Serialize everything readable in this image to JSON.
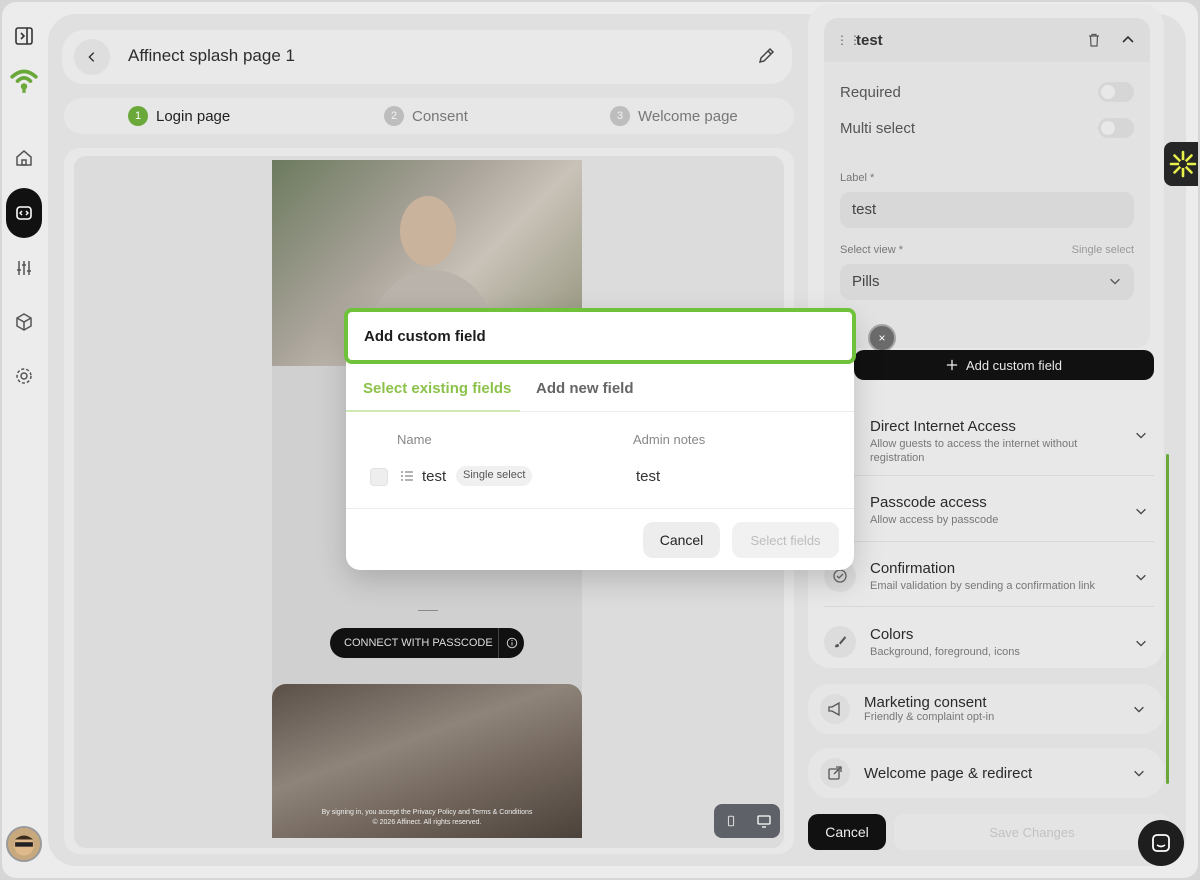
{
  "header": {
    "title": "Affinect splash page 1"
  },
  "steps": [
    {
      "num": "1",
      "label": "Login page"
    },
    {
      "num": "2",
      "label": "Consent"
    },
    {
      "num": "3",
      "label": "Welcome page"
    }
  ],
  "preview": {
    "connect_label": "CONNECT WITH PASSCODE",
    "legal_line1": "By signing in, you accept the Privacy Policy and Terms & Conditions",
    "legal_line2": "© 2026 Affinect. All rights reserved."
  },
  "field_card": {
    "name": "test",
    "required_label": "Required",
    "multi_select_label": "Multi select",
    "label_label": "Label *",
    "label_value": "test",
    "select_view_label": "Select view *",
    "select_view_hint": "Single select",
    "select_view_value": "Pills"
  },
  "add_custom_field_label": "Add custom field",
  "close_chip": "×",
  "accordion": [
    {
      "title": "Direct Internet Access",
      "subtitle": "Allow guests to access the internet without registration"
    },
    {
      "title": "Passcode access",
      "subtitle": "Allow access by passcode"
    },
    {
      "title": "Confirmation",
      "subtitle": "Email validation by sending a confirmation link"
    },
    {
      "title": "Colors",
      "subtitle": "Background, foreground, icons"
    }
  ],
  "cards": [
    {
      "title": "Marketing consent",
      "subtitle": "Friendly & complaint opt-in"
    },
    {
      "title": "Welcome page & redirect",
      "subtitle": ""
    }
  ],
  "footer": {
    "cancel": "Cancel",
    "save": "Save Changes"
  },
  "modal": {
    "title": "Add custom field",
    "tabs": [
      "Select existing fields",
      "Add new field"
    ],
    "columns": [
      "Name",
      "Admin notes"
    ],
    "rows": [
      {
        "name": "test",
        "badge": "Single select",
        "notes": "test"
      }
    ],
    "cancel": "Cancel",
    "select": "Select fields"
  },
  "colors": {
    "accent_green": "#6aa83a",
    "highlight_green": "#6fc23a",
    "dark": "#111111"
  }
}
